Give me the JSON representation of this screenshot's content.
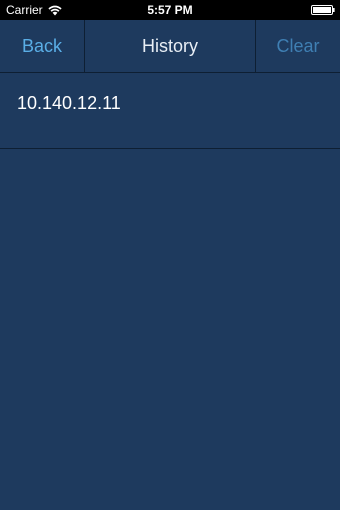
{
  "status_bar": {
    "carrier": "Carrier",
    "time": "5:57 PM",
    "wifi_icon": "wifi-icon",
    "battery_icon": "battery-icon"
  },
  "nav": {
    "back_label": "Back",
    "title": "History",
    "clear_label": "Clear"
  },
  "history": {
    "items": [
      {
        "label": "10.140.12.11"
      }
    ]
  },
  "colors": {
    "background": "#1e3a5e",
    "accent": "#5aaee6",
    "accent_dim": "#3f7fb3",
    "separator": "#0e1f33"
  }
}
